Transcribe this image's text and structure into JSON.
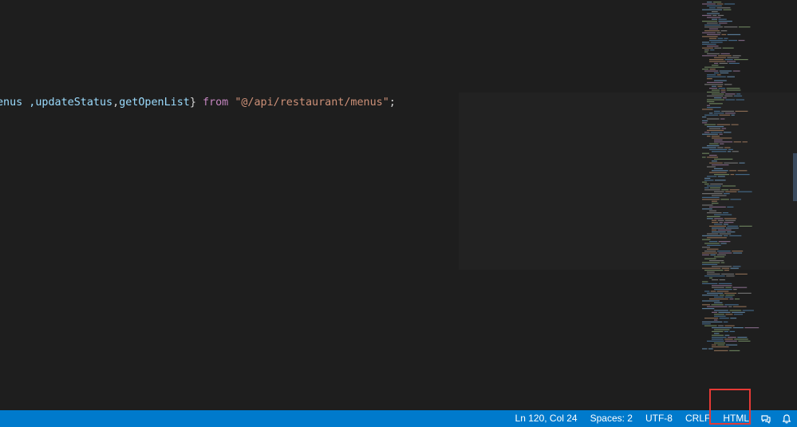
{
  "editor": {
    "code_line": {
      "t1": "enus ,",
      "t2": "updateStatus",
      "t3": ",",
      "t4": "getOpenList",
      "t5": "} ",
      "t6": "from",
      "t7": " ",
      "t8": "\"@/api/restaurant/menus\"",
      "t9": ";"
    }
  },
  "statusbar": {
    "cursor_position": "Ln 120, Col 24",
    "indentation": "Spaces: 2",
    "encoding": "UTF-8",
    "line_ending": "CRLF",
    "language_mode": "HTML",
    "feedback_icon": "feedback-icon",
    "notifications_icon": "bell-icon"
  },
  "colors": {
    "editor_bg": "#1e1e1e",
    "statusbar_bg": "#007acc",
    "identifier": "#9cdcfe",
    "keyword": "#c586c0",
    "string": "#ce9178",
    "annotation": "#e53935"
  }
}
